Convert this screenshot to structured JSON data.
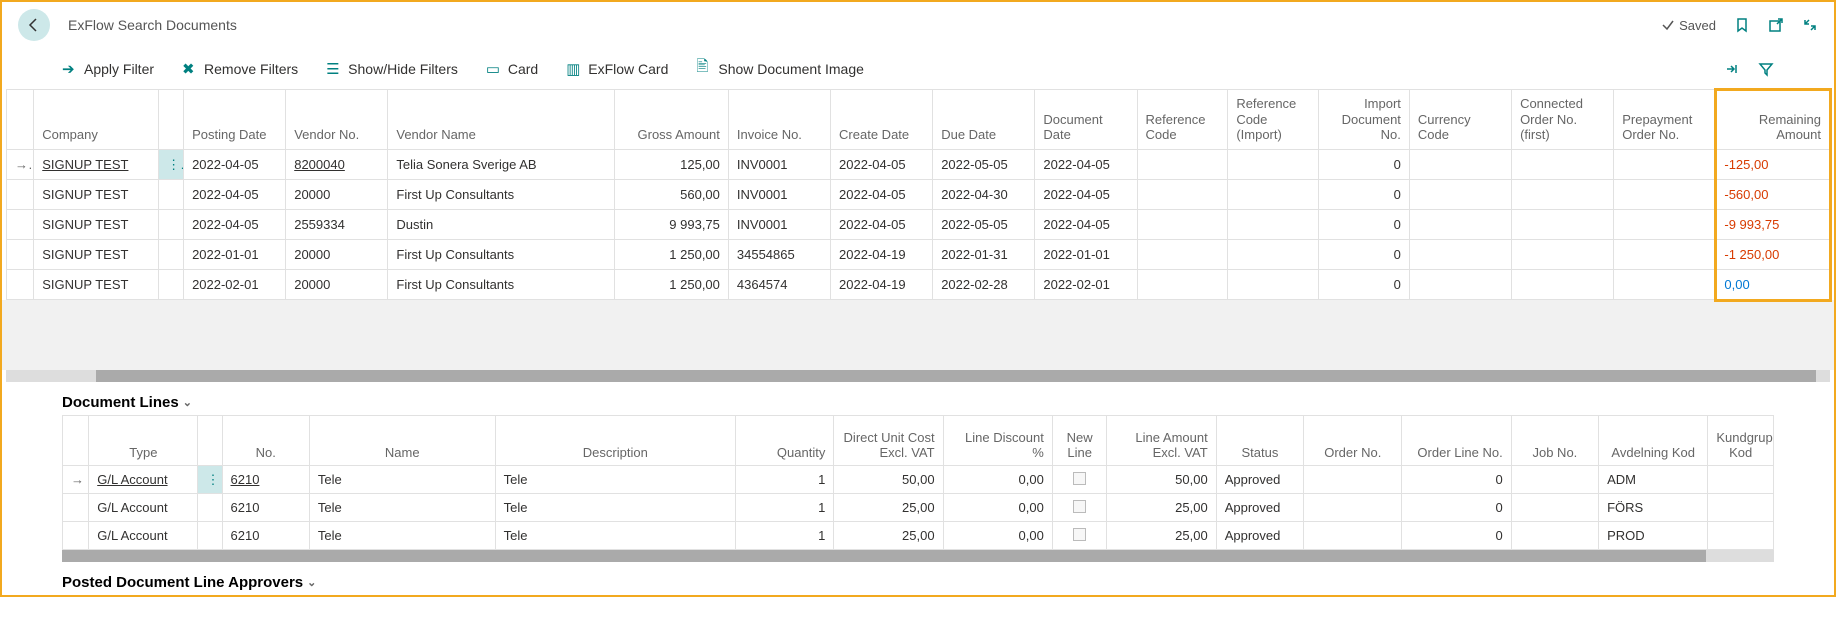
{
  "header": {
    "title": "ExFlow Search Documents",
    "saved": "Saved"
  },
  "toolbar": {
    "apply": "Apply Filter",
    "remove": "Remove Filters",
    "showhide": "Show/Hide Filters",
    "card": "Card",
    "exflowcard": "ExFlow Card",
    "showimage": "Show Document Image"
  },
  "cols": {
    "company": "Company",
    "posting": "Posting Date",
    "vendorno": "Vendor No.",
    "vendorname": "Vendor Name",
    "gross": "Gross Amount",
    "invoice": "Invoice No.",
    "create": "Create Date",
    "due": "Due Date",
    "docdate": "Document Date",
    "refcode": "Reference Code",
    "refcodeimp": "Reference Code (Import)",
    "impdoc": "Import Document No.",
    "currency": "Currency Code",
    "connorder": "Connected Order No. (first)",
    "prepay": "Prepayment Order No.",
    "remaining": "Remaining Amount"
  },
  "rows": [
    {
      "company": "SIGNUP TEST",
      "posting": "2022-04-05",
      "vendorno": "8200040",
      "vendorname": "Telia Sonera Sverige AB",
      "gross": "125,00",
      "invoice": "INV0001",
      "create": "2022-04-05",
      "due": "2022-05-05",
      "docdate": "2022-04-05",
      "impdoc": "0",
      "remaining": "-125,00",
      "sel": true
    },
    {
      "company": "SIGNUP TEST",
      "posting": "2022-04-05",
      "vendorno": "20000",
      "vendorname": "First Up Consultants",
      "gross": "560,00",
      "invoice": "INV0001",
      "create": "2022-04-05",
      "due": "2022-04-30",
      "docdate": "2022-04-05",
      "impdoc": "0",
      "remaining": "-560,00",
      "sel": false
    },
    {
      "company": "SIGNUP TEST",
      "posting": "2022-04-05",
      "vendorno": "2559334",
      "vendorname": "Dustin",
      "gross": "9 993,75",
      "invoice": "INV0001",
      "create": "2022-04-05",
      "due": "2022-05-05",
      "docdate": "2022-04-05",
      "impdoc": "0",
      "remaining": "-9 993,75",
      "sel": false
    },
    {
      "company": "SIGNUP TEST",
      "posting": "2022-01-01",
      "vendorno": "20000",
      "vendorname": "First Up Consultants",
      "gross": "1 250,00",
      "invoice": "34554865",
      "create": "2022-04-19",
      "due": "2022-01-31",
      "docdate": "2022-01-01",
      "impdoc": "0",
      "remaining": "-1 250,00",
      "sel": false
    },
    {
      "company": "SIGNUP TEST",
      "posting": "2022-02-01",
      "vendorno": "20000",
      "vendorname": "First Up Consultants",
      "gross": "1 250,00",
      "invoice": "4364574",
      "create": "2022-04-19",
      "due": "2022-02-28",
      "docdate": "2022-02-01",
      "impdoc": "0",
      "remaining": "0,00",
      "sel": false
    }
  ],
  "section1": "Document Lines",
  "section2": "Posted Document Line Approvers",
  "lcols": {
    "type": "Type",
    "no": "No.",
    "name": "Name",
    "desc": "Description",
    "qty": "Quantity",
    "unit": "Direct Unit Cost Excl. VAT",
    "disc": "Line Discount %",
    "newline": "New Line",
    "lineamt": "Line Amount Excl. VAT",
    "status": "Status",
    "orderno": "Order No.",
    "orderlineno": "Order Line No.",
    "jobno": "Job No.",
    "avd": "Avdelning Kod",
    "kund": "Kundgrup Kod"
  },
  "lines": [
    {
      "type": "G/L Account",
      "no": "6210",
      "name": "Tele",
      "desc": "Tele",
      "qty": "1",
      "unit": "50,00",
      "disc": "0,00",
      "lineamt": "50,00",
      "status": "Approved",
      "orderlineno": "0",
      "avd": "ADM",
      "sel": true
    },
    {
      "type": "G/L Account",
      "no": "6210",
      "name": "Tele",
      "desc": "Tele",
      "qty": "1",
      "unit": "25,00",
      "disc": "0,00",
      "lineamt": "25,00",
      "status": "Approved",
      "orderlineno": "0",
      "avd": "FÖRS",
      "sel": false
    },
    {
      "type": "G/L Account",
      "no": "6210",
      "name": "Tele",
      "desc": "Tele",
      "qty": "1",
      "unit": "25,00",
      "disc": "0,00",
      "lineamt": "25,00",
      "status": "Approved",
      "orderlineno": "0",
      "avd": "PROD",
      "sel": false
    }
  ]
}
